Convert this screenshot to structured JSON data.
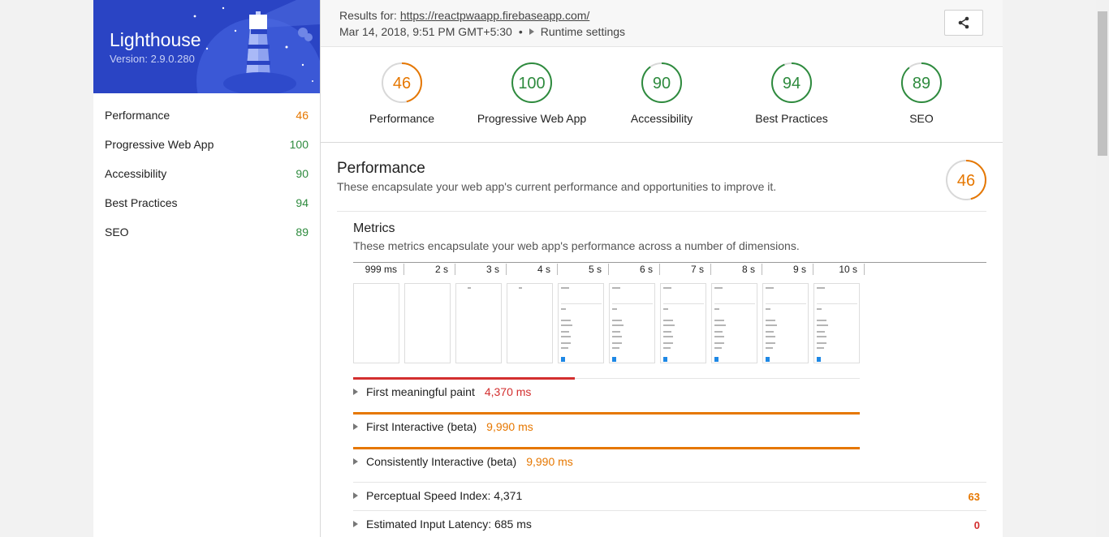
{
  "app": {
    "title": "Lighthouse",
    "version": "Version: 2.9.0.280"
  },
  "sidebar": {
    "items": [
      {
        "label": "Performance",
        "score": "46",
        "color": "#e67700"
      },
      {
        "label": "Progressive Web App",
        "score": "100",
        "color": "#2e8b3e"
      },
      {
        "label": "Accessibility",
        "score": "90",
        "color": "#2e8b3e"
      },
      {
        "label": "Best Practices",
        "score": "94",
        "color": "#2e8b3e"
      },
      {
        "label": "SEO",
        "score": "89",
        "color": "#2e8b3e"
      }
    ]
  },
  "header": {
    "results_label": "Results for:",
    "url": "https://reactpwaapp.firebaseapp.com/",
    "date": "Mar 14, 2018, 9:51 PM GMT+5:30",
    "bullet": "•",
    "runtime_settings": "Runtime settings",
    "share_icon": "share-icon"
  },
  "gauges": [
    {
      "label": "Performance",
      "score": "46",
      "value": 46,
      "color": "#e67700"
    },
    {
      "label": "Progressive Web App",
      "score": "100",
      "value": 100,
      "color": "#2e8b3e"
    },
    {
      "label": "Accessibility",
      "score": "90",
      "value": 90,
      "color": "#2e8b3e"
    },
    {
      "label": "Best Practices",
      "score": "94",
      "value": 94,
      "color": "#2e8b3e"
    },
    {
      "label": "SEO",
      "score": "89",
      "value": 89,
      "color": "#2e8b3e"
    }
  ],
  "performance": {
    "title": "Performance",
    "description": "These encapsulate your web app's current performance and opportunities to improve it.",
    "score": "46",
    "value": 46,
    "color": "#e67700"
  },
  "metrics": {
    "title": "Metrics",
    "description": "These metrics encapsulate your web app's performance across a number of dimensions.",
    "timeline": [
      "999 ms",
      "2 s",
      "3 s",
      "4 s",
      "5 s",
      "6 s",
      "7 s",
      "8 s",
      "9 s",
      "10 s"
    ],
    "rows": [
      {
        "label": "First meaningful paint",
        "value": "4,370 ms",
        "color": "#d32f2f",
        "bar_fraction": 0.437,
        "bar_color": "#d32f2f"
      },
      {
        "label": "First Interactive (beta)",
        "value": "9,990 ms",
        "color": "#e67700",
        "bar_fraction": 1.0,
        "bar_color": "#e67700"
      },
      {
        "label": "Consistently Interactive (beta)",
        "value": "9,990 ms",
        "color": "#e67700",
        "bar_fraction": 1.0,
        "bar_color": "#e67700"
      }
    ],
    "extra_rows": [
      {
        "label": "Perceptual Speed Index: 4,371",
        "score": "63",
        "color": "#e67700"
      },
      {
        "label": "Estimated Input Latency: 685 ms",
        "score": "0",
        "color": "#d32f2f"
      }
    ]
  }
}
